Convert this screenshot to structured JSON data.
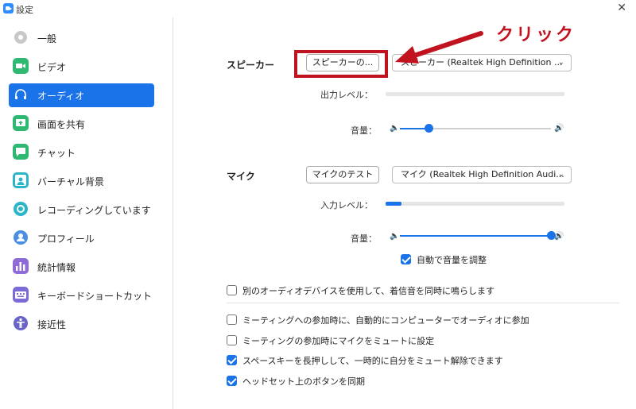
{
  "window": {
    "title": "設定",
    "close_glyph": "✕"
  },
  "sidebar": {
    "items": [
      {
        "label": "一般",
        "icon": "gear-icon",
        "color": "#b0b0b0"
      },
      {
        "label": "ビデオ",
        "icon": "video-camera-icon",
        "color": "#2eb872"
      },
      {
        "label": "オーディオ",
        "icon": "headphones-icon",
        "color": "#ffffff",
        "active": true
      },
      {
        "label": "画面を共有",
        "icon": "share-screen-icon",
        "color": "#2eb872"
      },
      {
        "label": "チャット",
        "icon": "chat-bubble-icon",
        "color": "#2eb872"
      },
      {
        "label": "バーチャル背景",
        "icon": "person-background-icon",
        "color": "#2bb5c9"
      },
      {
        "label": "レコーディングしています",
        "icon": "record-icon",
        "color": "#2bb5c9"
      },
      {
        "label": "プロフィール",
        "icon": "profile-icon",
        "color": "#4a90e2"
      },
      {
        "label": "統計情報",
        "icon": "statistics-icon",
        "color": "#8e6bd6"
      },
      {
        "label": "キーボードショートカット",
        "icon": "keyboard-icon",
        "color": "#7a6bd6"
      },
      {
        "label": "接近性",
        "icon": "accessibility-icon",
        "color": "#6a63c9"
      }
    ],
    "active_color": "#1a73e8"
  },
  "speaker": {
    "section_label": "スピーカー",
    "test_button": "スピーカーの...",
    "device": "スピーカー (Realtek High Definition ...",
    "output_level_label": "出力レベル：",
    "output_level": 0,
    "volume_label": "音量：",
    "volume": 0.19
  },
  "mic": {
    "section_label": "マイク",
    "test_button": "マイクのテスト",
    "device": "マイク (Realtek High Definition Audi...",
    "input_level_label": "入力レベル：",
    "input_level": 0.09,
    "volume_label": "音量：",
    "volume": 1.0,
    "auto_adjust_label": "自動で音量を調整",
    "auto_adjust": true
  },
  "options": [
    {
      "label": "別のオーディオデバイスを使用して、着信音を同時に鳴らします",
      "checked": false
    },
    {
      "label": "ミーティングへの参加時に、自動的にコンピューターでオーディオに参加",
      "checked": false
    },
    {
      "label": "ミーティングの参加時にマイクをミュートに設定",
      "checked": false
    },
    {
      "label": "スペースキーを長押しして、一時的に自分をミュート解除できます",
      "checked": true
    },
    {
      "label": "ヘッドセット上のボタンを同期",
      "checked": true
    }
  ],
  "annotation": {
    "text": "クリック",
    "color": "#c1121f"
  }
}
